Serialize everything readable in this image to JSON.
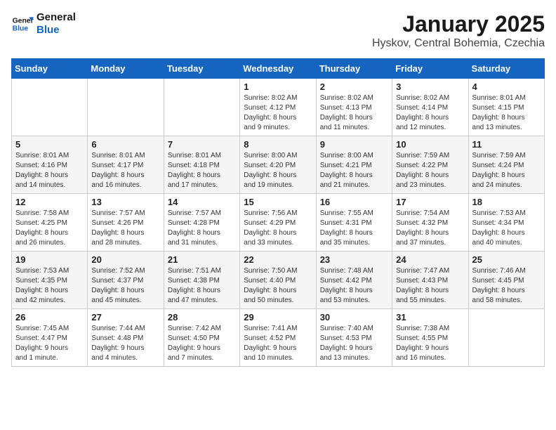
{
  "header": {
    "logo_line1": "General",
    "logo_line2": "Blue",
    "title": "January 2025",
    "subtitle": "Hyskov, Central Bohemia, Czechia"
  },
  "days_of_week": [
    "Sunday",
    "Monday",
    "Tuesday",
    "Wednesday",
    "Thursday",
    "Friday",
    "Saturday"
  ],
  "weeks": [
    [
      {
        "day": "",
        "info": ""
      },
      {
        "day": "",
        "info": ""
      },
      {
        "day": "",
        "info": ""
      },
      {
        "day": "1",
        "info": "Sunrise: 8:02 AM\nSunset: 4:12 PM\nDaylight: 8 hours\nand 9 minutes."
      },
      {
        "day": "2",
        "info": "Sunrise: 8:02 AM\nSunset: 4:13 PM\nDaylight: 8 hours\nand 11 minutes."
      },
      {
        "day": "3",
        "info": "Sunrise: 8:02 AM\nSunset: 4:14 PM\nDaylight: 8 hours\nand 12 minutes."
      },
      {
        "day": "4",
        "info": "Sunrise: 8:01 AM\nSunset: 4:15 PM\nDaylight: 8 hours\nand 13 minutes."
      }
    ],
    [
      {
        "day": "5",
        "info": "Sunrise: 8:01 AM\nSunset: 4:16 PM\nDaylight: 8 hours\nand 14 minutes."
      },
      {
        "day": "6",
        "info": "Sunrise: 8:01 AM\nSunset: 4:17 PM\nDaylight: 8 hours\nand 16 minutes."
      },
      {
        "day": "7",
        "info": "Sunrise: 8:01 AM\nSunset: 4:18 PM\nDaylight: 8 hours\nand 17 minutes."
      },
      {
        "day": "8",
        "info": "Sunrise: 8:00 AM\nSunset: 4:20 PM\nDaylight: 8 hours\nand 19 minutes."
      },
      {
        "day": "9",
        "info": "Sunrise: 8:00 AM\nSunset: 4:21 PM\nDaylight: 8 hours\nand 21 minutes."
      },
      {
        "day": "10",
        "info": "Sunrise: 7:59 AM\nSunset: 4:22 PM\nDaylight: 8 hours\nand 23 minutes."
      },
      {
        "day": "11",
        "info": "Sunrise: 7:59 AM\nSunset: 4:24 PM\nDaylight: 8 hours\nand 24 minutes."
      }
    ],
    [
      {
        "day": "12",
        "info": "Sunrise: 7:58 AM\nSunset: 4:25 PM\nDaylight: 8 hours\nand 26 minutes."
      },
      {
        "day": "13",
        "info": "Sunrise: 7:57 AM\nSunset: 4:26 PM\nDaylight: 8 hours\nand 28 minutes."
      },
      {
        "day": "14",
        "info": "Sunrise: 7:57 AM\nSunset: 4:28 PM\nDaylight: 8 hours\nand 31 minutes."
      },
      {
        "day": "15",
        "info": "Sunrise: 7:56 AM\nSunset: 4:29 PM\nDaylight: 8 hours\nand 33 minutes."
      },
      {
        "day": "16",
        "info": "Sunrise: 7:55 AM\nSunset: 4:31 PM\nDaylight: 8 hours\nand 35 minutes."
      },
      {
        "day": "17",
        "info": "Sunrise: 7:54 AM\nSunset: 4:32 PM\nDaylight: 8 hours\nand 37 minutes."
      },
      {
        "day": "18",
        "info": "Sunrise: 7:53 AM\nSunset: 4:34 PM\nDaylight: 8 hours\nand 40 minutes."
      }
    ],
    [
      {
        "day": "19",
        "info": "Sunrise: 7:53 AM\nSunset: 4:35 PM\nDaylight: 8 hours\nand 42 minutes."
      },
      {
        "day": "20",
        "info": "Sunrise: 7:52 AM\nSunset: 4:37 PM\nDaylight: 8 hours\nand 45 minutes."
      },
      {
        "day": "21",
        "info": "Sunrise: 7:51 AM\nSunset: 4:38 PM\nDaylight: 8 hours\nand 47 minutes."
      },
      {
        "day": "22",
        "info": "Sunrise: 7:50 AM\nSunset: 4:40 PM\nDaylight: 8 hours\nand 50 minutes."
      },
      {
        "day": "23",
        "info": "Sunrise: 7:48 AM\nSunset: 4:42 PM\nDaylight: 8 hours\nand 53 minutes."
      },
      {
        "day": "24",
        "info": "Sunrise: 7:47 AM\nSunset: 4:43 PM\nDaylight: 8 hours\nand 55 minutes."
      },
      {
        "day": "25",
        "info": "Sunrise: 7:46 AM\nSunset: 4:45 PM\nDaylight: 8 hours\nand 58 minutes."
      }
    ],
    [
      {
        "day": "26",
        "info": "Sunrise: 7:45 AM\nSunset: 4:47 PM\nDaylight: 9 hours\nand 1 minute."
      },
      {
        "day": "27",
        "info": "Sunrise: 7:44 AM\nSunset: 4:48 PM\nDaylight: 9 hours\nand 4 minutes."
      },
      {
        "day": "28",
        "info": "Sunrise: 7:42 AM\nSunset: 4:50 PM\nDaylight: 9 hours\nand 7 minutes."
      },
      {
        "day": "29",
        "info": "Sunrise: 7:41 AM\nSunset: 4:52 PM\nDaylight: 9 hours\nand 10 minutes."
      },
      {
        "day": "30",
        "info": "Sunrise: 7:40 AM\nSunset: 4:53 PM\nDaylight: 9 hours\nand 13 minutes."
      },
      {
        "day": "31",
        "info": "Sunrise: 7:38 AM\nSunset: 4:55 PM\nDaylight: 9 hours\nand 16 minutes."
      },
      {
        "day": "",
        "info": ""
      }
    ]
  ]
}
